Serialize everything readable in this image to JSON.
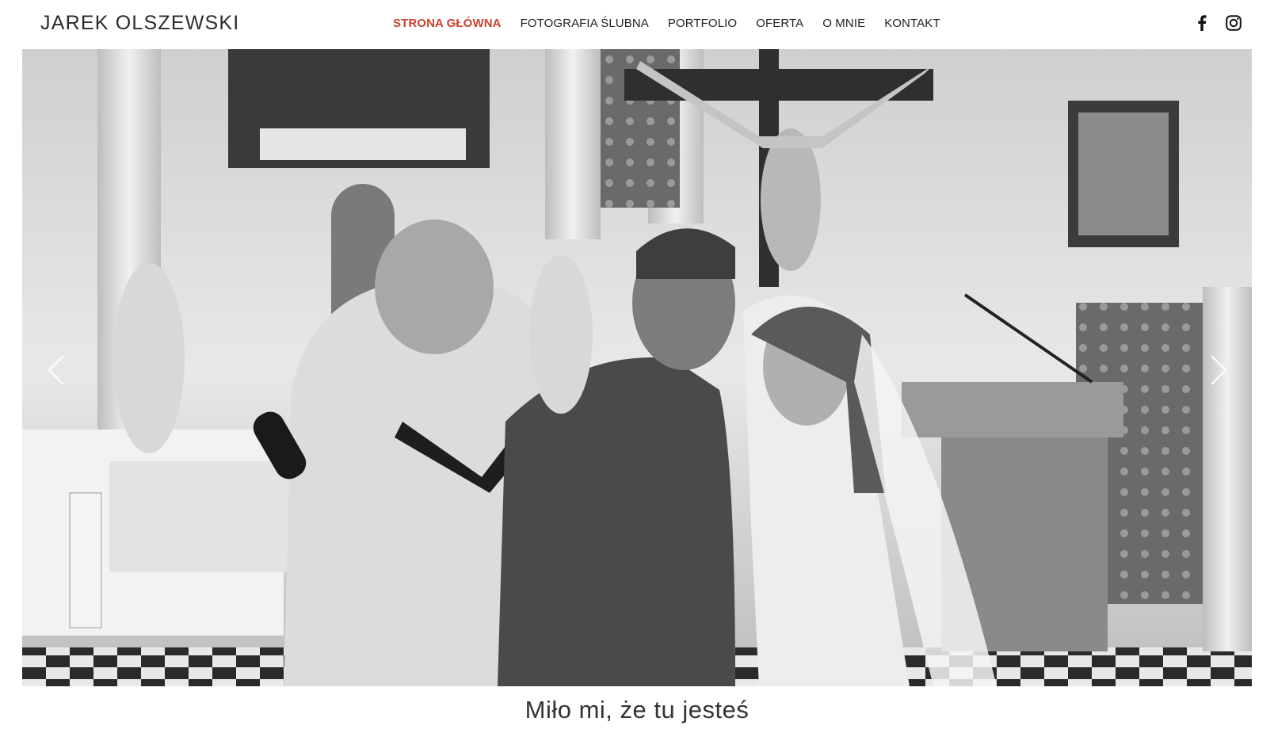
{
  "header": {
    "logo": "JAREK OLSZEWSKI",
    "nav": [
      {
        "label": "STRONA GŁÓWNA",
        "active": true
      },
      {
        "label": "FOTOGRAFIA ŚLUBNA",
        "active": false
      },
      {
        "label": "PORTFOLIO",
        "active": false
      },
      {
        "label": "OFERTA",
        "active": false
      },
      {
        "label": "O MNIE",
        "active": false
      },
      {
        "label": "KONTAKT",
        "active": false
      }
    ],
    "social": [
      {
        "icon": "facebook-icon"
      },
      {
        "icon": "instagram-icon"
      }
    ]
  },
  "hero": {
    "image_description_icon": "photo",
    "prev_icon": "chevron-left-icon",
    "next_icon": "chevron-right-icon"
  },
  "tagline": "Miło mi, że tu jesteś",
  "colors": {
    "accent": "#c9432f",
    "text": "#222222",
    "background": "#ffffff"
  }
}
